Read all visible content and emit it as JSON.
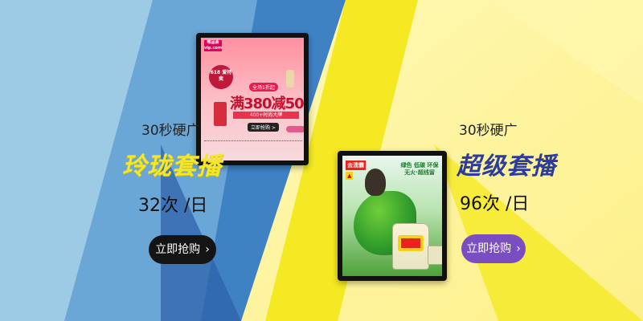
{
  "left_promo": {
    "duration_label": "30秒硬广",
    "package_name": "玲珑套播",
    "frequency": "32次 /日",
    "cta_label": "立即抢购",
    "cta_icon": "chevron-right-icon",
    "accent_color": "#f4e62a"
  },
  "right_promo": {
    "duration_label": "30秒硬广",
    "package_name": "超级套播",
    "frequency": "96次 /日",
    "cta_label": "立即抢购",
    "cta_icon": "chevron-right-icon",
    "accent_color": "#2b3b9e"
  },
  "left_screen": {
    "logo_text": "唯品会 vip.com",
    "badge_text": "618 爱特卖",
    "subheadline": "全场1折起",
    "headline": "满380减50",
    "strip_text": "400+时尚大牌",
    "cta_text": "立即抢购 >"
  },
  "right_screen": {
    "brand_text": "去渍霸",
    "slogan_text": "绿色 低碳 环保 无火·超线留"
  },
  "colors": {
    "bg_blue_light": "#a7d3e8",
    "bg_blue": "#4a8cc5",
    "bg_navy": "#2a5aa6",
    "bg_yellow": "#f7ee3a",
    "bg_yellow_pale": "#fdf6a6"
  }
}
